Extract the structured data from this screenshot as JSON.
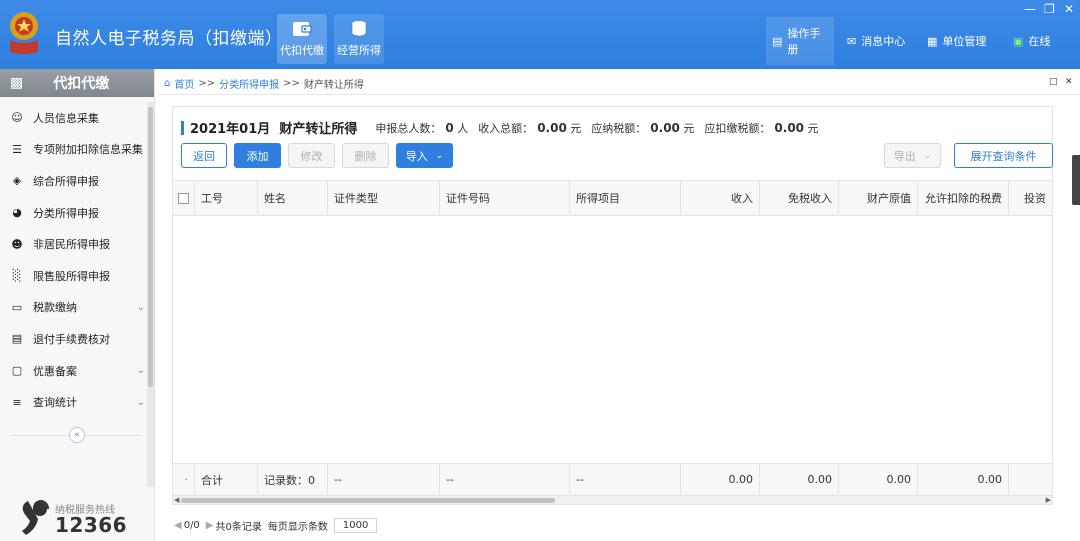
{
  "header": {
    "app_title": "自然人电子税务局（扣缴端）",
    "modules": [
      {
        "label": "代扣代缴",
        "icon": "wallet-icon"
      },
      {
        "label": "经营所得",
        "icon": "coins-icon"
      }
    ],
    "nav": [
      {
        "label": "操作手册",
        "icon": "manual-icon"
      },
      {
        "label": "消息中心",
        "icon": "mail-icon"
      },
      {
        "label": "单位管理",
        "icon": "building-icon"
      },
      {
        "label": "在线",
        "icon": "online-icon"
      }
    ],
    "accent": "#2f7fe0"
  },
  "sidebar": {
    "title": "代扣代缴",
    "items": [
      {
        "label": "人员信息采集",
        "icon": "person-icon",
        "has_arrow": false
      },
      {
        "label": "专项附加扣除信息采集",
        "icon": "list-icon",
        "has_arrow": false
      },
      {
        "label": "综合所得申报",
        "icon": "layers-icon",
        "has_arrow": false
      },
      {
        "label": "分类所得申报",
        "icon": "pie-icon",
        "has_arrow": false
      },
      {
        "label": "非居民所得申报",
        "icon": "user-icon",
        "has_arrow": false
      },
      {
        "label": "限售股所得申报",
        "icon": "bar-chart-icon",
        "has_arrow": false
      },
      {
        "label": "税款缴纳",
        "icon": "folder-icon",
        "has_arrow": true
      },
      {
        "label": "退付手续费核对",
        "icon": "receipt-icon",
        "has_arrow": false
      },
      {
        "label": "优惠备案",
        "icon": "document-icon",
        "has_arrow": true
      },
      {
        "label": "查询统计",
        "icon": "search-list-icon",
        "has_arrow": true
      }
    ],
    "hotline_label": "纳税服务热线",
    "hotline_number": "12366"
  },
  "breadcrumb": {
    "home": "首页",
    "sep": ">>",
    "level1": "分类所得申报",
    "current": "财产转让所得"
  },
  "panel": {
    "title": "2021年01月  财产转让所得",
    "stats": [
      {
        "label": "申报总人数：",
        "value": "0",
        "unit": "人"
      },
      {
        "label": "收入总额：",
        "value": "0.00",
        "unit": "元"
      },
      {
        "label": "应纳税额：",
        "value": "0.00",
        "unit": "元"
      },
      {
        "label": "应扣缴税额：",
        "value": "0.00",
        "unit": "元"
      }
    ],
    "buttons": {
      "back": "返回",
      "add": "添加",
      "edit": "修改",
      "delete": "删除",
      "import": "导入",
      "export": "导出",
      "expand_query": "展开查询条件"
    }
  },
  "table": {
    "columns": [
      "工号",
      "姓名",
      "证件类型",
      "证件号码",
      "所得项目",
      "收入",
      "免税收入",
      "财产原值",
      "允许扣除的税费",
      "投资"
    ],
    "rows": [],
    "footer": {
      "total_label": "合计",
      "record_count": "记录数：0",
      "dash": "--",
      "income": "0.00",
      "tax_free": "0.00",
      "original_value": "0.00",
      "deductible_tax": "0.00"
    }
  },
  "pager": {
    "position": "0/0",
    "total": "共0条记录",
    "per_page_label": "每页显示条数",
    "per_page": "1000"
  }
}
